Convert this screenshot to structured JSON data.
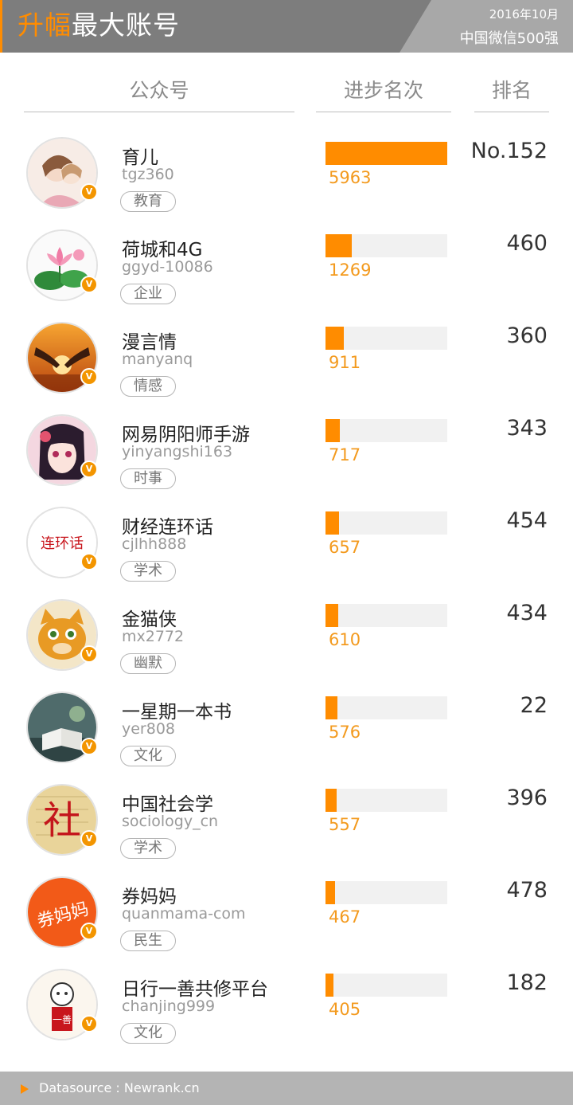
{
  "header": {
    "title_highlight": "升幅",
    "title_rest": "最大账号",
    "date": "2016年10月",
    "subtitle": "中国微信500强"
  },
  "columns": {
    "account": "公众号",
    "progress": "进步名次",
    "rank": "排名"
  },
  "colors": {
    "accent": "#ff8c00",
    "bar_track": "#f1f1f1",
    "badge": "#f39500"
  },
  "badge_label": "V",
  "rows": [
    {
      "name": "育儿",
      "account": "tgz360",
      "tag": "教育",
      "progress": 5963,
      "rank": "No.152",
      "avatar_icon": "anime-girl-avatar-icon"
    },
    {
      "name": "荷城和4G",
      "account": "ggyd-10086",
      "tag": "企业",
      "progress": 1269,
      "rank": "460",
      "avatar_icon": "lotus-avatar-icon"
    },
    {
      "name": "漫言情",
      "account": "manyanq",
      "tag": "情感",
      "progress": 911,
      "rank": "360",
      "avatar_icon": "sunset-hands-avatar-icon"
    },
    {
      "name": "网易阴阳师手游",
      "account": "yinyangshi163",
      "tag": "时事",
      "progress": 717,
      "rank": "343",
      "avatar_icon": "anime-character-avatar-icon"
    },
    {
      "name": "财经连环话",
      "account": "cjlhh888",
      "tag": "学术",
      "progress": 657,
      "rank": "454",
      "avatar_icon": "lianhuanhua-logo-avatar-icon"
    },
    {
      "name": "金猫侠",
      "account": "mx2772",
      "tag": "幽默",
      "progress": 610,
      "rank": "434",
      "avatar_icon": "cat-avatar-icon"
    },
    {
      "name": "一星期一本书",
      "account": "yer808",
      "tag": "文化",
      "progress": 576,
      "rank": "22",
      "avatar_icon": "book-avatar-icon"
    },
    {
      "name": "中国社会学",
      "account": "sociology_cn",
      "tag": "学术",
      "progress": 557,
      "rank": "396",
      "avatar_icon": "she-calligraphy-avatar-icon"
    },
    {
      "name": "券妈妈",
      "account": "quanmama-com",
      "tag": "民生",
      "progress": 467,
      "rank": "478",
      "avatar_icon": "quanmama-logo-avatar-icon"
    },
    {
      "name": "日行一善共修平台",
      "account": "chanjing999",
      "tag": "文化",
      "progress": 405,
      "rank": "182",
      "avatar_icon": "monk-cartoon-avatar-icon"
    }
  ],
  "chart_data": {
    "type": "bar",
    "categories": [
      "育儿",
      "荷城和4G",
      "漫言情",
      "网易阴阳师手游",
      "财经连环话",
      "金猫侠",
      "一星期一本书",
      "中国社会学",
      "券妈妈",
      "日行一善共修平台"
    ],
    "values": [
      5963,
      1269,
      911,
      717,
      657,
      610,
      576,
      557,
      467,
      405
    ],
    "xlabel": "",
    "ylabel": "进步名次",
    "ylim": [
      0,
      5963
    ]
  },
  "footer": {
    "source": "Datasource : Newrank.cn"
  }
}
